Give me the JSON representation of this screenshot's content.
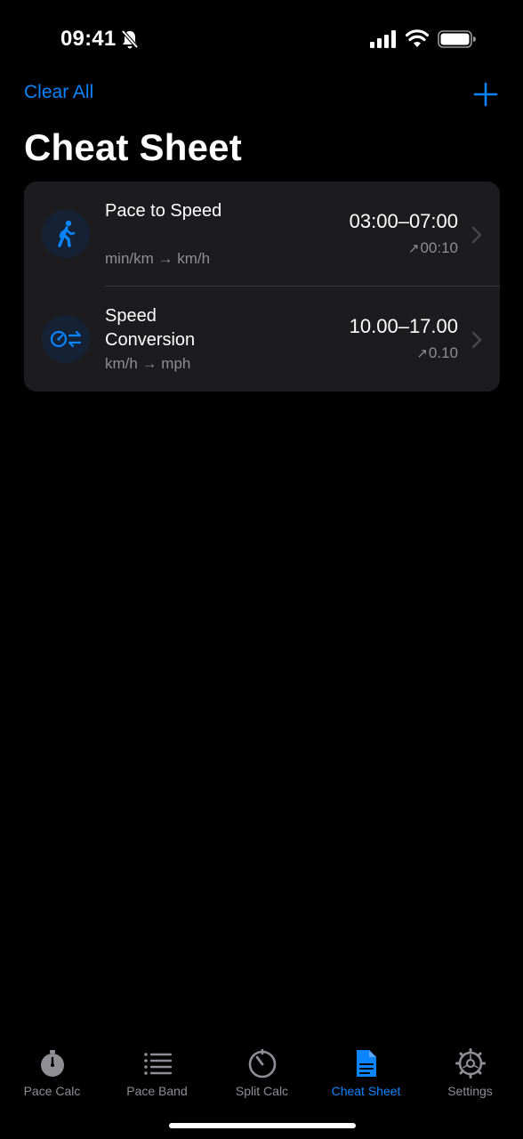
{
  "status_bar": {
    "time": "09:41"
  },
  "nav": {
    "clear_all_label": "Clear All",
    "title": "Cheat Sheet"
  },
  "rows": [
    {
      "title": "Pace to Speed",
      "subtitle": "min/km → km/h",
      "range": "03:00–07:00",
      "step_arrow": "↗",
      "step": "00:10",
      "icon": "walking-person-icon"
    },
    {
      "title": "Speed Conversion",
      "subtitle": "km/h → mph",
      "range": "10.00–17.00",
      "step_arrow": "↗",
      "step": "0.10",
      "icon": "speedometer-exchange-icon"
    }
  ],
  "tabs": [
    {
      "label": "Pace Calc",
      "icon": "stopwatch-icon",
      "active": false
    },
    {
      "label": "Pace Band",
      "icon": "list-icon",
      "active": false
    },
    {
      "label": "Split Calc",
      "icon": "timer-icon",
      "active": false
    },
    {
      "label": "Cheat Sheet",
      "icon": "document-icon",
      "active": true
    },
    {
      "label": "Settings",
      "icon": "gear-icon",
      "active": false
    }
  ],
  "colors": {
    "accent": "#0a84ff",
    "background": "#000000",
    "card": "#1c1c1e",
    "secondary_text": "#8e8e93"
  }
}
